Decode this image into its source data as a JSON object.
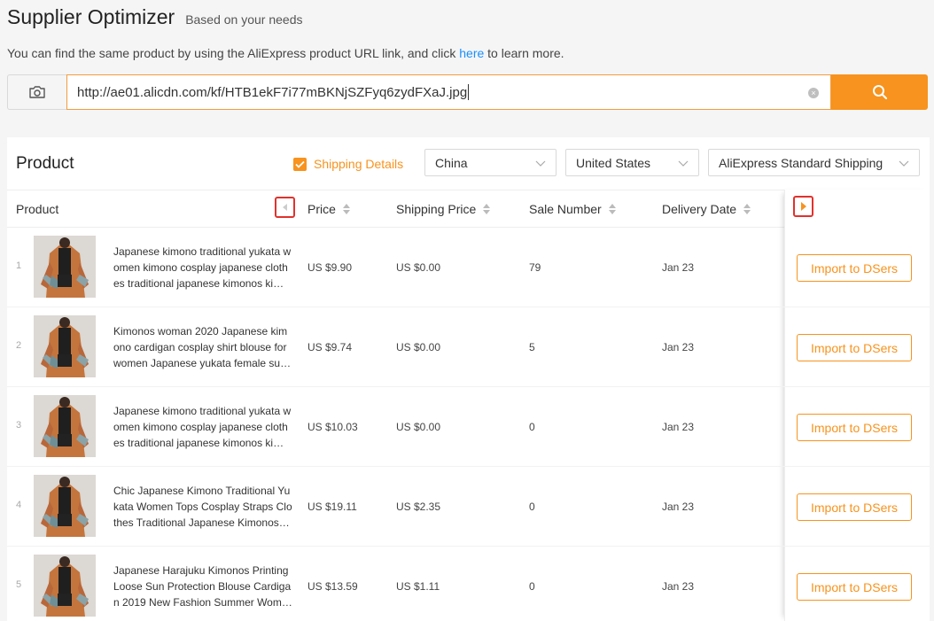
{
  "header": {
    "title": "Supplier Optimizer",
    "subtitle": "Based on your needs",
    "desc_before": "You can find the same product by using the AliExpress product URL link, and click ",
    "desc_link": "here",
    "desc_after": " to learn more."
  },
  "search": {
    "value": "http://ae01.alicdn.com/kf/HTB1ekF7i77mBKNjSZFyq6zydFXaJ.jpg",
    "clear_icon": "×"
  },
  "panel": {
    "title": "Product",
    "shipping_details_label": "Shipping Details",
    "shipping_details_checked": true,
    "ship_from": "China",
    "ship_to": "United States",
    "shipping_method": "AliExpress Standard Shipping"
  },
  "table": {
    "columns": {
      "product": "Product",
      "price": "Price",
      "shipping_price": "Shipping Price",
      "sale_number": "Sale Number",
      "delivery_date": "Delivery Date"
    },
    "import_label": "Import to DSers",
    "rows": [
      {
        "index": "1",
        "name": "Japanese kimono traditional yukata women kimono cosplay japanese clothes traditional japanese kimonos kimono cardigan",
        "price": "US $9.90",
        "shipping": "US $0.00",
        "sales": "79",
        "delivery": "Jan 23"
      },
      {
        "index": "2",
        "name": "Kimonos woman 2020 Japanese kimono cardigan cosplay shirt blouse for women Japanese yukata female summer beach kimono",
        "price": "US $9.74",
        "shipping": "US $0.00",
        "sales": "5",
        "delivery": "Jan 23"
      },
      {
        "index": "3",
        "name": "Japanese kimono traditional yukata women kimono cosplay japanese clothes traditional japanese kimonos kimono cardigan",
        "price": "US $10.03",
        "shipping": "US $0.00",
        "sales": "0",
        "delivery": "Jan 23"
      },
      {
        "index": "4",
        "name": "Chic Japanese Kimono Traditional Yukata Women Tops Cosplay Straps Clothes Traditional Japanese Kimonos Cardigan",
        "price": "US $19.11",
        "shipping": "US $2.35",
        "sales": "0",
        "delivery": "Jan 23"
      },
      {
        "index": "5",
        "name": "Japanese Harajuku Kimonos Printing Loose Sun Protection Blouse Cardigan 2019 New Fashion Summer Women Kimono",
        "price": "US $13.59",
        "shipping": "US $1.11",
        "sales": "0",
        "delivery": "Jan 23"
      }
    ]
  },
  "colors": {
    "accent": "#f7931e",
    "link": "#1890ff",
    "highlight_border": "#e0322d"
  },
  "icons": {
    "camera": "camera-icon",
    "search": "search-icon",
    "clear": "clear-icon",
    "chevron": "chevron-down-icon",
    "prev": "arrow-left-icon",
    "next": "arrow-right-icon"
  }
}
